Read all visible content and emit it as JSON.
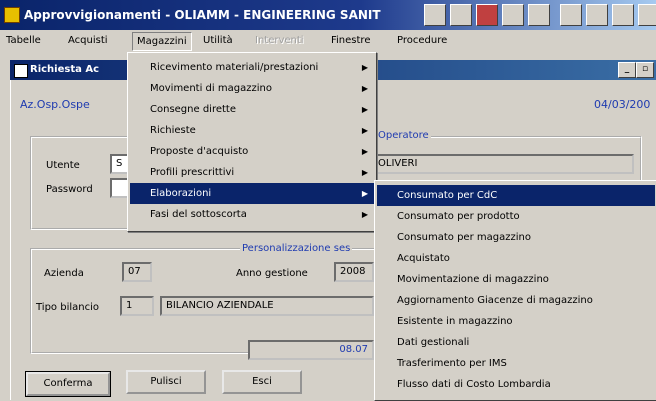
{
  "app": {
    "title": "Approvvigionamenti - OLIAMM - ENGINEERING SANIT"
  },
  "menubar": {
    "items": [
      "Tabelle",
      "Acquisti",
      "Magazzini",
      "Utilità",
      "Interventi",
      "Finestre",
      "Procedure"
    ]
  },
  "window": {
    "title": "Richiesta Ac",
    "org": "Az.Osp.Ospe",
    "date": "04/03/200"
  },
  "login": {
    "user_label": "Utente",
    "user_value": "S",
    "password_label": "Password",
    "name_value": "OLIVERI",
    "group_label": "Operatore"
  },
  "config": {
    "title": "Personalizzazione ses",
    "azienda_label": "Azienda",
    "azienda_value": "07",
    "anno_label": "Anno gestione",
    "anno_value": "2008",
    "bilancio_label": "Tipo bilancio",
    "bilancio_code": "1",
    "bilancio_desc": "BILANCIO AZIENDALE",
    "time_value": "08.07"
  },
  "buttons": {
    "confirm": "Conferma",
    "clear": "Pulisci",
    "exit": "Esci"
  },
  "magazzini_menu": [
    "Ricevimento materiali/prestazioni",
    "Movimenti di magazzino",
    "Consegne dirette",
    "Richieste",
    "Proposte d'acquisto",
    "Profili prescrittivi",
    "Elaborazioni",
    "Fasi del sottoscorta"
  ],
  "elaborazioni_menu": [
    "Consumato per CdC",
    "Consumato per prodotto",
    "Consumato per magazzino",
    "Acquistato",
    "Movimentazione di magazzino",
    "Aggiornamento Giacenze di magazzino",
    "Esistente in magazzino",
    "Dati gestionali",
    "Trasferimento per IMS",
    "Flusso dati di Costo Lombardia"
  ]
}
